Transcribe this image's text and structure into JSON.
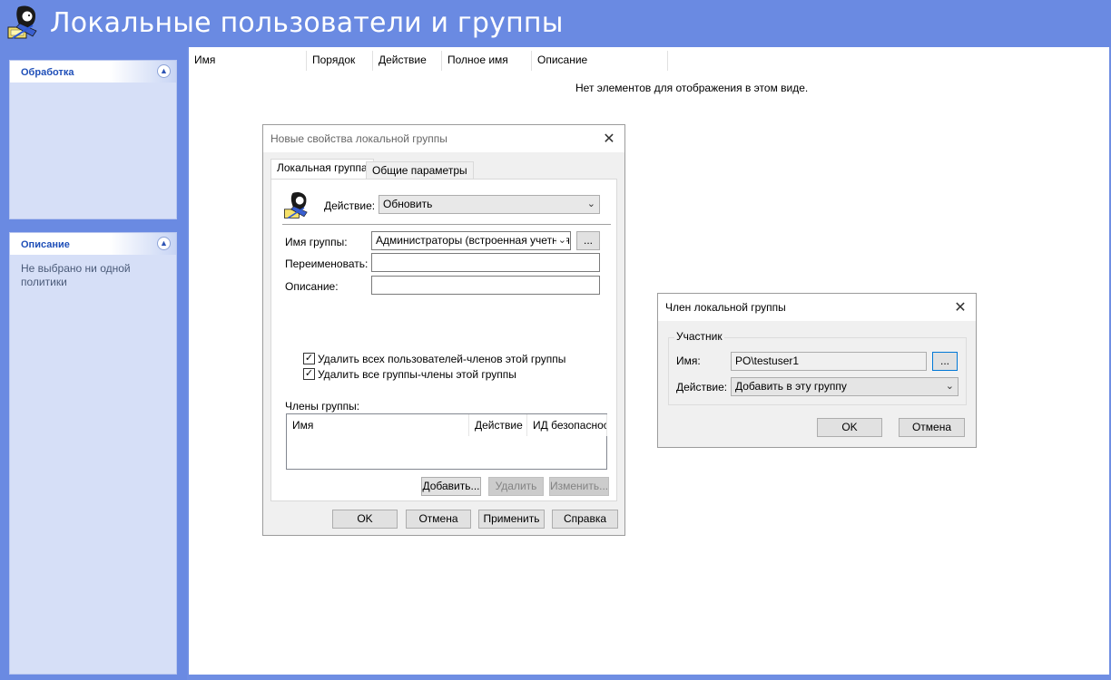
{
  "header": {
    "title": "Локальные пользователи и группы",
    "icon": "users-groups-icon"
  },
  "left_pane": {
    "processing": {
      "title": "Обработка"
    },
    "description": {
      "title": "Описание",
      "text": "Не выбрано ни одной политики"
    }
  },
  "list": {
    "columns": [
      "Имя",
      "Порядок",
      "Действие",
      "Полное имя",
      "Описание"
    ],
    "empty_message": "Нет элементов для отображения в этом виде."
  },
  "group_dialog": {
    "title": "Новые свойства локальной группы",
    "tabs": [
      "Локальная группа",
      "Общие параметры"
    ],
    "action_label": "Действие:",
    "action_value": "Обновить",
    "group_name_label": "Имя группы:",
    "group_name_value": "Администраторы (встроенная учетная",
    "browse_label": "...",
    "rename_label": "Переименовать:",
    "rename_value": "",
    "description_label": "Описание:",
    "description_value": "",
    "checkbox_delete_users": {
      "label": "Удалить всех пользователей-членов этой группы",
      "checked": true
    },
    "checkbox_delete_groups": {
      "label": "Удалить все группы-члены этой группы",
      "checked": true
    },
    "members_label": "Члены группы:",
    "members_columns": [
      "Имя",
      "Действие",
      "ИД безопасност"
    ],
    "add_button": "Добавить...",
    "remove_button": "Удалить",
    "edit_button": "Изменить...",
    "ok_button": "OK",
    "cancel_button": "Отмена",
    "apply_button": "Применить",
    "help_button": "Справка"
  },
  "member_dialog": {
    "title": "Член локальной группы",
    "group_title": "Участник",
    "name_label": "Имя:",
    "name_value": "PO\\testuser1",
    "browse_label": "...",
    "action_label": "Действие:",
    "action_value": "Добавить в эту группу",
    "ok_button": "OK",
    "cancel_button": "Отмена"
  }
}
